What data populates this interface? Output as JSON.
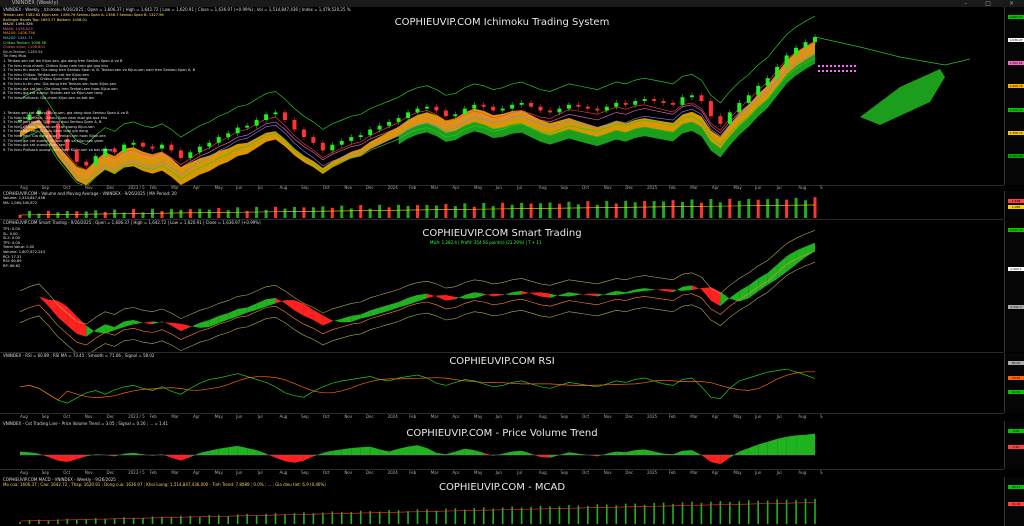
{
  "window": {
    "title": "VNINDEX (Weekly)",
    "header_line": "VNINDEX - Weekly ; Ichimoku 9/26/2025 ; Open = 1,606.37 | High = 1,642.72 | Low = 1,620.91 | Close = 1,636.97 (+0.99%) ; Vol = 1,514,847,436 | Index = 1,479,520,25 %"
  },
  "panes": {
    "ichimoku": {
      "title": "COPHIEUVIP.COM Ichimoku Trading System",
      "legend": [
        "Tenkan-sen: 1582.62  Kijun-sen: 1496.76  Senkou Span A: 1358.7  Senkou Span B: 1327.96",
        "Bollinger Bands Top: 1693.77  Bottom: 1458.01",
        "MA20: 1494.326",
        "MA50: 1476.523",
        "MA100: 1408.756",
        "MA200: 1341.71",
        "Chikou-Tenkan: 1006.36",
        "Chikou-Kijun: 1108.803",
        "Kijun-Tenkan: 1183.54",
        "Tin hieu Mua",
        "1. Tenkan-sen cat len Kijun-sen, gia dong tren Senkou Span A va B",
        "2. Tin hieu mua nhanh: Chikou Span nam tren gia qua khu",
        "3. Tin hieu tin manh: Gia dong tren Senkou Span A, B. Tenkan-sen va Kijun-sen nam tren Senkou Span A, B",
        "4. Tin hieu Chikou: Tenkan-sen cat len Kijun-sen",
        "5. Tin hieu cai nhat: Chikou Span tren gia dong",
        "6. Tin hieu tu tin yeu: Gia dong tren Tenkan-sen hoac Kijun-sen",
        "7. Tin hieu gia cat len: Gia dong tren Tenkan-sen hoac Kijun-sen",
        "8. Tin hieu gia cat xuong: Tenkan-sen va Kijun-sen tang",
        "9. Tin hieu Pullback: Gia cham Kijun-sen va bat len"
      ],
      "legend_sell": [
        "1. Tenkan-sen cat xuong Kijun-sen, gia dong duoi Senkou Span A va B",
        "2. Tin hieu ban nhanh: Chikou Span nam duoi gia qua khu",
        "3. Tin hieu ban manh: Gia dong duoi Senkou Span A, B",
        "4. Tin hieu Chikou: Tenkan-sen cat xuong Kijun-sen",
        "5. Tin hieu ban yeu: Chikou Span duoi gia dong",
        "6. Tin hieu yeu: Gia dong duoi Tenkan-sen hoac Kijun-sen",
        "7. Tin hieu gia cat xuong: Tenkan-sen va Kijun-sen giam",
        "8. Tin hieu gia cat xuong Kijun-sen",
        "9. Tin hieu Pullback xuong: Gia cham Kijun-sen va bat xuong"
      ],
      "scale": [
        {
          "label": "1,693.77",
          "color": "#00c800"
        },
        {
          "label": "1,636.97",
          "color": "#ffffff"
        },
        {
          "label": "1,582.62",
          "color": "#ff66cc"
        },
        {
          "label": "1,496.76",
          "color": "#ffb000"
        },
        {
          "label": "1,458.01",
          "color": "#00c800"
        },
        {
          "label": "1,358.70",
          "color": "#ffcc00"
        },
        {
          "label": "1,327.96",
          "color": "#00aa00"
        }
      ]
    },
    "volume": {
      "header": "COPHIEUVIP.COM - Volume and Moving Average - VNINDEX - 9/26/2025 | MA Period: 20",
      "legend": [
        "Volume: 1,514,847,436",
        "MA: 1,084,340,872"
      ],
      "scale": [
        {
          "label": "1.51B",
          "color": "#ff4040"
        },
        {
          "label": "1.08B",
          "color": "#ffd000"
        }
      ]
    },
    "smart": {
      "header": "COPHIEUVIP.COM Smart Trading - 9/26/2025 ; Open = 1,606.37 | High = 1,642.72 | Low = 1,620.91 | Close = 1,636.97 (+0.99%)",
      "title": "COPHIEUVIP.COM Smart Trading",
      "note": "MUA: 1,282.4 | Profit: 354.56 point(s) (21.29%) | T + 11",
      "legend": [
        "TP1: 0.00",
        "SL: 0.00",
        "SL2: 0.00",
        "TP2: 0.00",
        "Trend Value: 0.00",
        "Volume: 1,607,672,243",
        "RCI: 17.31",
        "RSI: 60.89",
        "RP: 66.62"
      ],
      "scale": [
        {
          "label": "1,642.72",
          "color": "#00c800"
        },
        {
          "label": "1,495.1",
          "color": "#ffffff"
        },
        {
          "label": "1,341.7",
          "color": "#aaaaaa"
        }
      ]
    },
    "rsi": {
      "header": "VNINDEX - RSI = 60.89 ; RSI MA = 73.45 ; Smooth = 71.06 ; Signal = 58.02",
      "title": "COPHIEUVIP.COM RSI",
      "scale": [
        {
          "label": "80.00",
          "color": "#aaaaaa"
        },
        {
          "label": "73.45",
          "color": "#ff6600"
        },
        {
          "label": "60.89",
          "color": "#00c800"
        }
      ]
    },
    "pvt": {
      "header": "VNINDEX - Cot Trading Line - Price Volume Trend = 3.05 ; Signal = 0.26 ; ... = 1.41",
      "title": "COPHIEUVIP.COM - Price Volume Trend",
      "scale": [
        {
          "label": "3.05",
          "color": "#00c800"
        },
        {
          "label": "0.26",
          "color": "#ff4040"
        }
      ]
    },
    "macd": {
      "header": "COPHIEUVIP.COM MACD - VNINDEX - Weekly - 9/26/2025",
      "subheader": "Mo cua: 1606.37 ; Cao: 1642.72 ; Thap: 1620.91 ; Dong cua: 1636.97 ; Khoi luong: 1,514,847,436,000 - Tinh Trend: 7.8089 ; 0.0% ; ... ; Gia dieu tiet: 6.9 (0.46%)",
      "title": "COPHIEUVIP.COM - MCAD",
      "scale": [
        {
          "label": "48.21",
          "color": "#00c800"
        },
        {
          "label": "31.26",
          "color": "#ff4040"
        }
      ]
    }
  },
  "time_axis": [
    "Aug",
    "Sep",
    "Oct",
    "Nov",
    "Dec",
    "2023 / 5",
    "Feb",
    "Mar",
    "Apr",
    "May",
    "Jun",
    "Jul",
    "Aug",
    "Sep",
    "Oct",
    "Nov",
    "Dec",
    "2024",
    "Feb",
    "Mar",
    "Apr",
    "May",
    "Jun",
    "Jul",
    "Aug",
    "Sep",
    "Oct",
    "Nov",
    "Dec",
    "2025",
    "Feb",
    "Mar",
    "Apr",
    "May",
    "Jun",
    "Jul",
    "Aug",
    "S"
  ],
  "chart_data": {
    "type": "line",
    "x_unit": "week index (Aug 2022 → Sep 2025)",
    "price_close": [
      1200,
      1230,
      1250,
      1180,
      1100,
      1040,
      980,
      960,
      1010,
      1050,
      1030,
      1070,
      1080,
      1060,
      1050,
      1070,
      1040,
      1000,
      1030,
      1060,
      1080,
      1110,
      1130,
      1160,
      1170,
      1200,
      1230,
      1240,
      1200,
      1150,
      1110,
      1080,
      1040,
      1070,
      1090,
      1110,
      1120,
      1150,
      1170,
      1190,
      1210,
      1240,
      1260,
      1270,
      1250,
      1220,
      1230,
      1260,
      1280,
      1270,
      1250,
      1260,
      1280,
      1290,
      1270,
      1250,
      1240,
      1260,
      1280,
      1270,
      1260,
      1250,
      1270,
      1290,
      1280,
      1300,
      1310,
      1300,
      1290,
      1280,
      1320,
      1330,
      1300,
      1220,
      1180,
      1240,
      1290,
      1330,
      1380,
      1420,
      1480,
      1540,
      1580,
      1610,
      1637
    ],
    "rsi": [
      50,
      52,
      48,
      40,
      32,
      28,
      35,
      42,
      45,
      40,
      46,
      50,
      52,
      48,
      45,
      50,
      44,
      40,
      48,
      55,
      60,
      62,
      65,
      68,
      64,
      60,
      56,
      50,
      42,
      38,
      36,
      44,
      50,
      55,
      58,
      60,
      62,
      64,
      60,
      58,
      62,
      64,
      66,
      62,
      55,
      52,
      56,
      60,
      58,
      54,
      50,
      52,
      56,
      58,
      54,
      50,
      48,
      52,
      56,
      54,
      52,
      50,
      54,
      58,
      56,
      60,
      62,
      58,
      54,
      52,
      60,
      62,
      50,
      36,
      34,
      48,
      58,
      62,
      66,
      70,
      72,
      74,
      70,
      66,
      61
    ],
    "pvt": [
      0.5,
      0.4,
      0.2,
      -0.3,
      -0.8,
      -1.0,
      -0.6,
      -0.2,
      0.1,
      0.0,
      -0.2,
      0.2,
      0.3,
      0.1,
      -0.1,
      0.1,
      -0.4,
      -0.8,
      -0.3,
      0.3,
      0.6,
      0.9,
      1.1,
      1.3,
      1.0,
      0.7,
      0.2,
      -0.4,
      -0.9,
      -1.1,
      -0.8,
      -0.2,
      0.3,
      0.6,
      0.8,
      1.0,
      1.1,
      1.2,
      0.8,
      0.5,
      0.9,
      1.2,
      1.4,
      1.0,
      0.3,
      0.1,
      0.5,
      0.9,
      0.7,
      0.3,
      -0.1,
      0.2,
      0.5,
      0.6,
      0.2,
      -0.3,
      -0.4,
      0.0,
      0.4,
      0.2,
      0.0,
      -0.2,
      0.2,
      0.5,
      0.4,
      0.7,
      0.8,
      0.5,
      0.2,
      0.1,
      0.6,
      0.7,
      0.0,
      -1.0,
      -1.3,
      -0.4,
      0.5,
      1.0,
      1.5,
      1.9,
      2.3,
      2.6,
      2.8,
      2.9,
      3.05
    ]
  }
}
